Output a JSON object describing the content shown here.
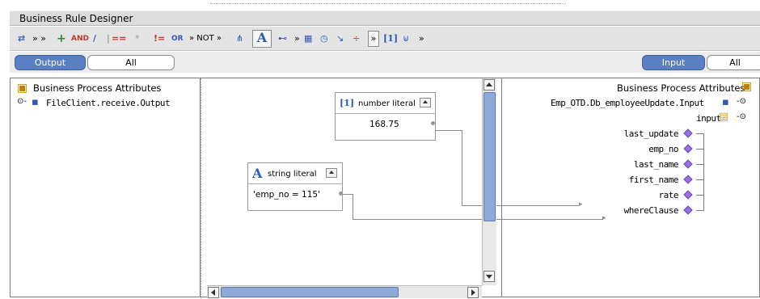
{
  "window": {
    "title": "Business Rule Designer"
  },
  "toolbar": {
    "items": [
      {
        "icon": "connect-icon",
        "label": "» »"
      },
      {
        "icon": "plus-icon",
        "label": "+"
      },
      {
        "icon": "and-icon",
        "label": "AND"
      },
      {
        "icon": "slash-icon",
        "label": "/"
      },
      {
        "icon": "equals-icon",
        "label": "=="
      },
      {
        "icon": "star-icon",
        "label": "*"
      },
      {
        "icon": "not-equal-icon",
        "label": "!="
      },
      {
        "icon": "or-icon",
        "label": "OR"
      },
      {
        "icon": "not-icon",
        "label": "» NOT »"
      },
      {
        "icon": "string-literal-icon",
        "label": "A"
      },
      {
        "icon": "number-literal-icon",
        "label": "[1]"
      }
    ]
  },
  "left_tabs": {
    "output": "Output",
    "all": "All"
  },
  "right_tabs": {
    "input": "Input",
    "all": "All"
  },
  "left_tree": {
    "root": "Business Process Attributes",
    "child": "FileClient.receive.Output"
  },
  "right_tree": {
    "root": "Business Process Attributes",
    "child": "Emp_OTD.Db_employeeUpdate.Input",
    "sub": "input",
    "fields": [
      "last_update",
      "emp_no",
      "last_name",
      "first_name",
      "rate",
      "whereClause"
    ]
  },
  "canvas": {
    "number_literal": {
      "icon_text": "[1]",
      "label": "number literal",
      "value": "168.75"
    },
    "string_literal": {
      "icon_text": "A",
      "label": "string literal",
      "value": "'emp_no = 115'"
    }
  },
  "colors": {
    "tab_selected": "#5a7fc2",
    "field_diamond": "#9b6fe0",
    "scroll_thumb": "#8fa9d6"
  }
}
